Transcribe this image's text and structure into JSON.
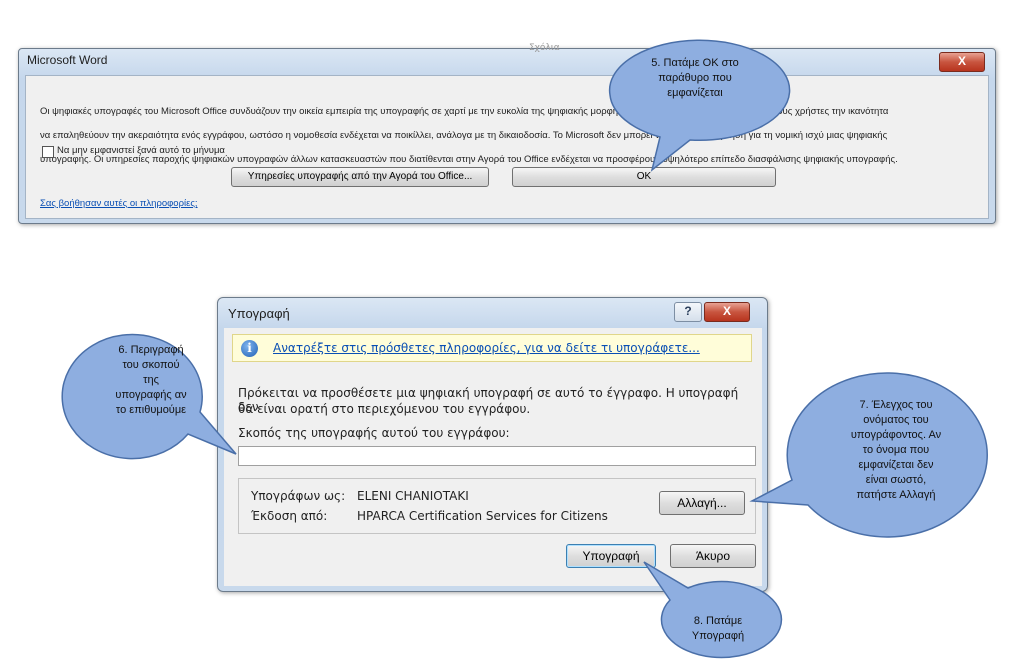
{
  "word_dialog": {
    "title": "Microsoft Word",
    "close_label": "X",
    "message_line1": "Οι ψηφιακές υπογραφές του Microsoft Office συνδυάζουν την οικεία εμπειρία της υπογραφής σε χαρτί με την ευκολία της ψηφιακής μορφής. Οι ψηφιακές υπογραφές παρέχει στους χρήστες την ικανότητα",
    "message_line2": "να επαληθεύουν την ακεραιότητα ενός εγγράφου, ωστόσο η νομοθεσία ενδέχεται να ποικίλλει, ανάλογα με τη δικαιοδοσία. Το Microsoft δεν μπορεί να παράσχει εγγύηση για τη νομική ισχύ μιας ψηφιακής",
    "message_line3": "υπογραφής. Οι υπηρεσίες παροχής ψηφιακών υπογραφών άλλων κατασκευαστών που διατίθενται στην Αγορά του Office ενδέχεται να προσφέρουν υψηλότερο επίπεδο διασφάλισης ψηφιακής υπογραφής.",
    "dont_show_label": "Να μην εμφανιστεί ξανά αυτό το μήνυμα",
    "marketplace_button": "Υπηρεσίες υπογραφής από την Αγορά του Office...",
    "ok_button": "OK",
    "help_link": "Σας βοήθησαν αυτές οι πληροφορίες;",
    "background_fragment": "Σχόλια"
  },
  "sign_dialog": {
    "title": "Υπογραφή",
    "help_label": "?",
    "close_label": "X",
    "info_link": "Ανατρέξτε στις πρόσθετες πληροφορίες, για να δείτε τι υπογράφετε...",
    "description_line1": "Πρόκειται να προσθέσετε μια ψηφιακή υπογραφή σε αυτό το έγγραφο. Η υπογραφή δεν",
    "description_line2": "θα είναι ορατή στο περιεχόμενου του εγγράφου.",
    "purpose_label": "Σκοπός της υπογραφής αυτού του εγγράφου:",
    "purpose_value": "",
    "signing_as_label": "Υπογράφων ως:",
    "signing_as_value": "ELENI CHANIOTAKI",
    "issued_by_label": "Έκδοση από:",
    "issued_by_value": "HPARCA Certification Services for Citizens",
    "change_button": "Αλλαγή...",
    "sign_button": "Υπογραφή",
    "cancel_button": "Άκυρο"
  },
  "callouts": {
    "c5": {
      "line1": "5. Πατάμε ΟΚ στο",
      "line2": "παράθυρο που",
      "line3": "εμφανίζεται"
    },
    "c6": {
      "line1": "6. Περιγραφή",
      "line2": "του σκοπού",
      "line3": "της",
      "line4": "υπογραφής αν",
      "line5": "το επιθυμούμε"
    },
    "c7": {
      "line1": "7. Έλεγχος του",
      "line2": "ονόματος του",
      "line3": "υπογράφοντος. Αν",
      "line4": "το όνομα που",
      "line5": "εμφανίζεται δεν",
      "line6": "είναι σωστό,",
      "line7": "πατήστε Αλλαγή"
    },
    "c8": {
      "line1": "8. Πατάμε",
      "line2": "Υπογραφή"
    }
  },
  "colors": {
    "callout_fill": "#8eaee0",
    "callout_stroke": "#4a6fa8",
    "link": "#0a4fb4"
  }
}
